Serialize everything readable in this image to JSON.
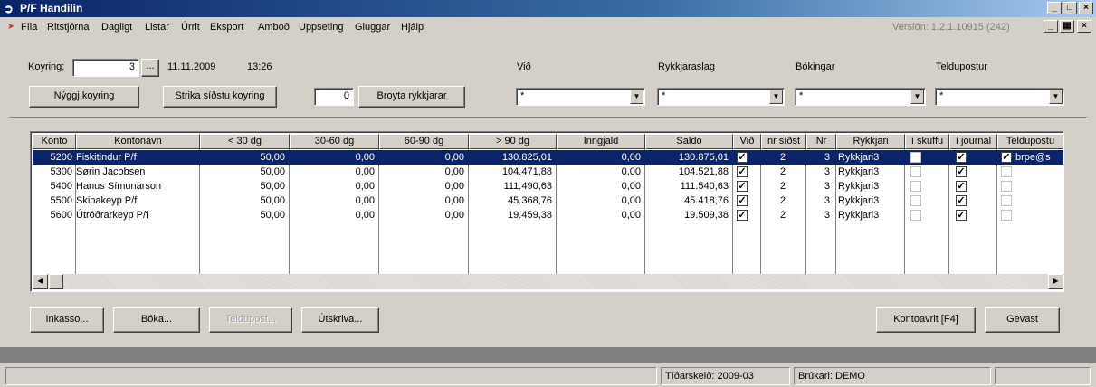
{
  "window": {
    "title": "P/F Handilin",
    "icon": "app-logo-icon",
    "controls": [
      "_",
      "□",
      "×"
    ]
  },
  "menu": {
    "items": [
      "Fíla",
      "Ritstjórna",
      "Dagligt",
      "Listar",
      "Úrrit",
      "Eksport",
      "Amboð",
      "Uppseting",
      "Gluggar",
      "Hjálp"
    ],
    "version": "Versión: 1.2.1.10915 (242)"
  },
  "header": {
    "koyring_label": "Koyring:",
    "koyring_value": "3",
    "ellipsis": "...",
    "date": "11.11.2009",
    "time": "13:26",
    "new_run_button": "Nýggj koyring",
    "delete_last_button": "Strika síðstu koyring",
    "counter_value": "0",
    "change_reminders_button": "Broyta rykkjarar"
  },
  "filters": {
    "vid_label": "Við",
    "vid_value": "*",
    "rykkjaraslag_label": "Rykkjaraslag",
    "rykkjaraslag_value": "*",
    "bokingar_label": "Bókingar",
    "bokingar_value": "*",
    "teldupostur_label": "Teldupostur",
    "teldupostur_value": "*"
  },
  "grid": {
    "columns": [
      "Konto",
      "Kontonavn",
      "< 30 dg",
      "30-60 dg",
      "60-90 dg",
      "> 90 dg",
      "Inngjald",
      "Saldo",
      "Við",
      "nr síðst",
      "Nr",
      "Rykkjari",
      "í skuffu",
      "í journal",
      "Teldupostu"
    ],
    "rows": [
      {
        "konto": "5200",
        "kontonavn": "Fiskitindur P/f",
        "lt30": "50,00",
        "d30_60": "0,00",
        "d60_90": "0,00",
        "gt90": "130.825,01",
        "inngjald": "0,00",
        "saldo": "130.875,01",
        "vid": true,
        "nr_sidst": "2",
        "nr": "3",
        "rykkjari": "Rykkjari3",
        "i_skuffu": false,
        "i_journal": true,
        "teldupostur": true,
        "email": "brpe@s",
        "selected": true
      },
      {
        "konto": "5300",
        "kontonavn": "Sørin Jacobsen",
        "lt30": "50,00",
        "d30_60": "0,00",
        "d60_90": "0,00",
        "gt90": "104.471,88",
        "inngjald": "0,00",
        "saldo": "104.521,88",
        "vid": true,
        "nr_sidst": "2",
        "nr": "3",
        "rykkjari": "Rykkjari3",
        "i_skuffu": false,
        "i_journal": true,
        "teldupostur": false,
        "email": "",
        "selected": false
      },
      {
        "konto": "5400",
        "kontonavn": "Hanus Símunarson",
        "lt30": "50,00",
        "d30_60": "0,00",
        "d60_90": "0,00",
        "gt90": "111.490,63",
        "inngjald": "0,00",
        "saldo": "111.540,63",
        "vid": true,
        "nr_sidst": "2",
        "nr": "3",
        "rykkjari": "Rykkjari3",
        "i_skuffu": false,
        "i_journal": true,
        "teldupostur": false,
        "email": "",
        "selected": false
      },
      {
        "konto": "5500",
        "kontonavn": "Skipakeyp P/f",
        "lt30": "50,00",
        "d30_60": "0,00",
        "d60_90": "0,00",
        "gt90": "45.368,76",
        "inngjald": "0,00",
        "saldo": "45.418,76",
        "vid": true,
        "nr_sidst": "2",
        "nr": "3",
        "rykkjari": "Rykkjari3",
        "i_skuffu": false,
        "i_journal": true,
        "teldupostur": false,
        "email": "",
        "selected": false
      },
      {
        "konto": "5600",
        "kontonavn": "Útróðrarkeyp P/f",
        "lt30": "50,00",
        "d30_60": "0,00",
        "d60_90": "0,00",
        "gt90": "19.459,38",
        "inngjald": "0,00",
        "saldo": "19.509,38",
        "vid": true,
        "nr_sidst": "2",
        "nr": "3",
        "rykkjari": "Rykkjari3",
        "i_skuffu": false,
        "i_journal": true,
        "teldupostur": false,
        "email": "",
        "selected": false
      }
    ]
  },
  "actions": {
    "inkasso": "Inkasso...",
    "boka": "Bóka...",
    "teldupost": "Teldupost...",
    "utskriva": "Útskriva...",
    "kontoavrit": "Kontoavrit [F4]",
    "gevast": "Gevast"
  },
  "status": {
    "period": "Tíðarskeið: 2009-03",
    "user": "Brúkari: DEMO"
  },
  "colors": {
    "selection": "#0a246a",
    "face": "#d4d0c8"
  }
}
